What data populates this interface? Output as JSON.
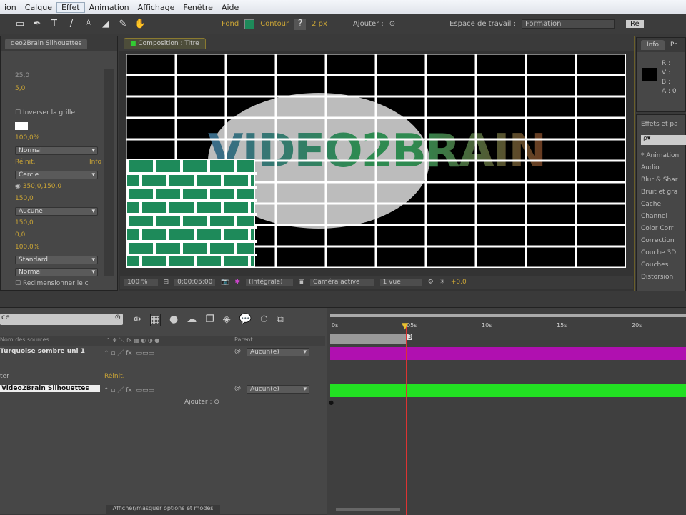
{
  "menu": [
    "ion",
    "Calque",
    "Effet",
    "Animation",
    "Affichage",
    "Fenêtre",
    "Aide"
  ],
  "toolbar": {
    "fond": "Fond",
    "contour": "Contour",
    "px": "2 px",
    "ajouter": "Ajouter :",
    "workspace_label": "Espace de travail :",
    "workspace_value": "Formation",
    "search": "Re"
  },
  "left_panel": {
    "tab": "deo2Brain Silhouettes",
    "values": {
      "v1": "25,0",
      "v2": "5,0",
      "invert": "Inverser la grille",
      "opacity1": "100,0%",
      "mode1": "Normal",
      "reinit": "Réinit.",
      "info": "Info",
      "shape": "Cercle",
      "point": "350,0,150,0",
      "v3": "150,0",
      "feather": "Aucune",
      "v4": "150,0",
      "v5": "0,0",
      "opacity2": "100,0%",
      "mode2": "Standard",
      "mode3": "Normal",
      "resize": "Redimensionner le c"
    }
  },
  "comp": {
    "tab": "Composition : Titre",
    "logo": "VIDEO2BRAIN",
    "footer": {
      "zoom": "100 %",
      "time": "0:00:05:00",
      "res": "(Intégrale)",
      "camera": "Caméra active",
      "views": "1 vue",
      "offset": "+0,0"
    }
  },
  "info_panel": {
    "tab": "Info",
    "tab2": "Pr",
    "r": "R :",
    "v": "V :",
    "b": "B :",
    "a": "A : 0"
  },
  "effects_panel": {
    "title": "Effets et pa",
    "search": "ρ▾",
    "items": [
      "* Animation",
      "Audio",
      "Blur & Shar",
      "Bruit et gra",
      "Cache",
      "Channel",
      "Color Corr",
      "Correction",
      "Couche 3D",
      "Couches",
      "Distorsion"
    ]
  },
  "timeline": {
    "search": "ce",
    "col_source": "Nom des sources",
    "col_parent": "Parent",
    "layers": [
      {
        "name": "Turquoise sombre uni 1",
        "parent": "Aucun(e)",
        "color": "#b010b0"
      },
      {
        "name": "Video2Brain Silhouettes",
        "parent": "Aucun(e)",
        "color": "#22e022",
        "sub": "ter",
        "reinit": "Réinit."
      }
    ],
    "ajouter": "Ajouter :",
    "ticks": [
      "0s",
      "05s",
      "10s",
      "15s",
      "20s"
    ],
    "footer": "Afficher/masquer options et modes"
  },
  "colors": {
    "accent": "#c9a436",
    "grid": "#ffffff",
    "brick": "#1e8a5a"
  }
}
